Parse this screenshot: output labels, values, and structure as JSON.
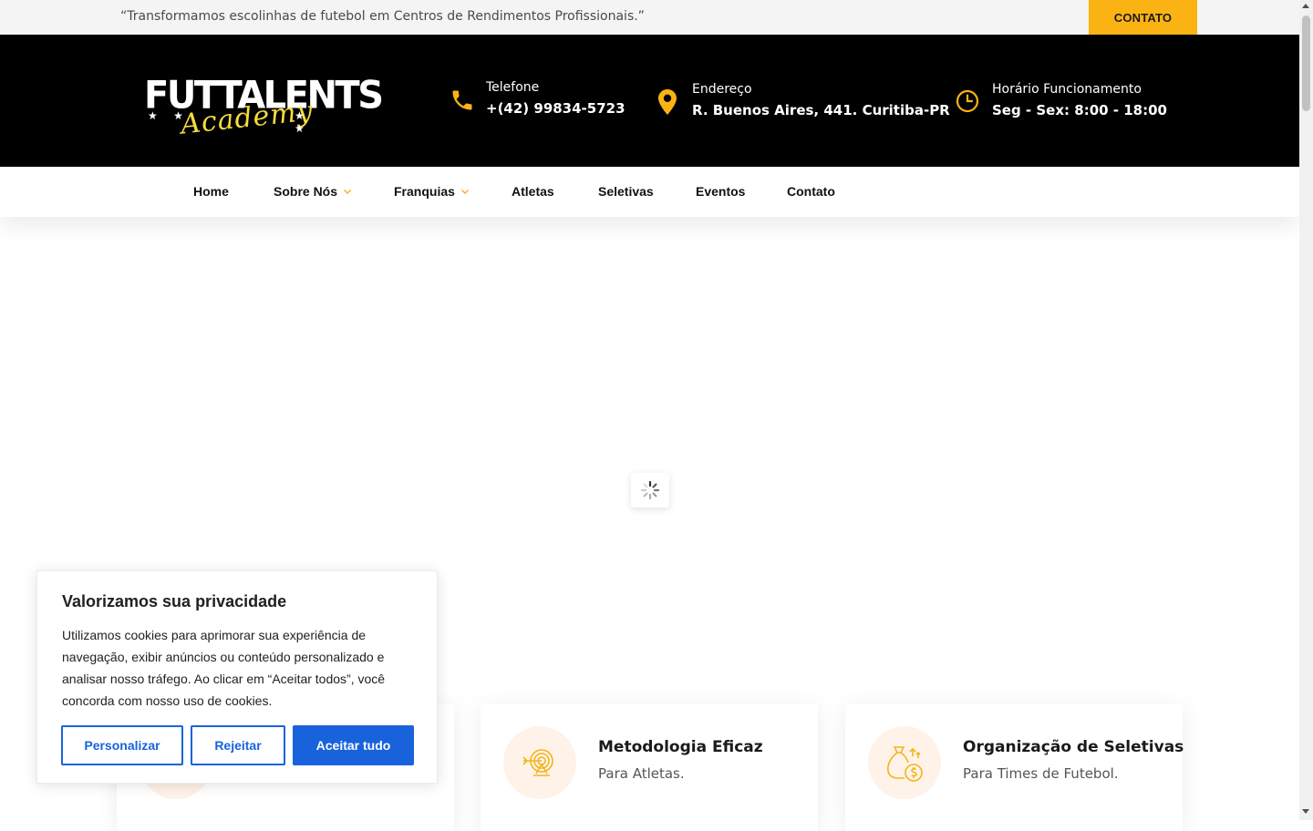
{
  "topbar": {
    "tagline": "“Transformamos escolinhas de futebol em Centros de Rendimentos Profissionais.”",
    "contact_button": "CONTATO"
  },
  "header": {
    "logo": {
      "word": "FUTTALENTS",
      "script": "Academy",
      "stars": "★ ★"
    },
    "info": [
      {
        "icon": "phone-icon",
        "label": "Telefone",
        "value": "+(42) 99834-5723"
      },
      {
        "icon": "location-pin-icon",
        "label": "Endereço",
        "value": "R. Buenos Aires, 441. Curitiba-PR"
      },
      {
        "icon": "clock-icon",
        "label": "Horário Funcionamento",
        "value": "Seg - Sex: 8:00 - 18:00"
      }
    ]
  },
  "nav": {
    "items": [
      {
        "label": "Home",
        "dropdown": false
      },
      {
        "label": "Sobre Nós",
        "dropdown": true
      },
      {
        "label": "Franquias",
        "dropdown": true
      },
      {
        "label": "Atletas",
        "dropdown": false
      },
      {
        "label": "Seletivas",
        "dropdown": false
      },
      {
        "label": "Eventos",
        "dropdown": false
      },
      {
        "label": "Contato",
        "dropdown": false
      }
    ]
  },
  "features": [
    {
      "icon": "target-icon",
      "title": "Metodologia Eficaz",
      "subtitle": "Para Atletas."
    },
    {
      "icon": "money-bag-icon",
      "title": "Organização de Seletivas",
      "subtitle": "Para Times de Futebol."
    }
  ],
  "cookie": {
    "title": "Valorizamos sua privacidade",
    "text": "Utilizamos cookies para aprimorar sua experiência de navegação, exibir anúncios ou conteúdo personalizado e analisar nosso tráfego. Ao clicar em “Aceitar todos”, você concorda com nosso uso de cookies.",
    "customize": "Personalizar",
    "reject": "Rejeitar",
    "accept": "Aceitar tudo"
  },
  "colors": {
    "accent": "#fbb314",
    "header_bg": "#000000",
    "cookie_blue": "#1863dc",
    "icon_circle": "#fff2e8"
  }
}
